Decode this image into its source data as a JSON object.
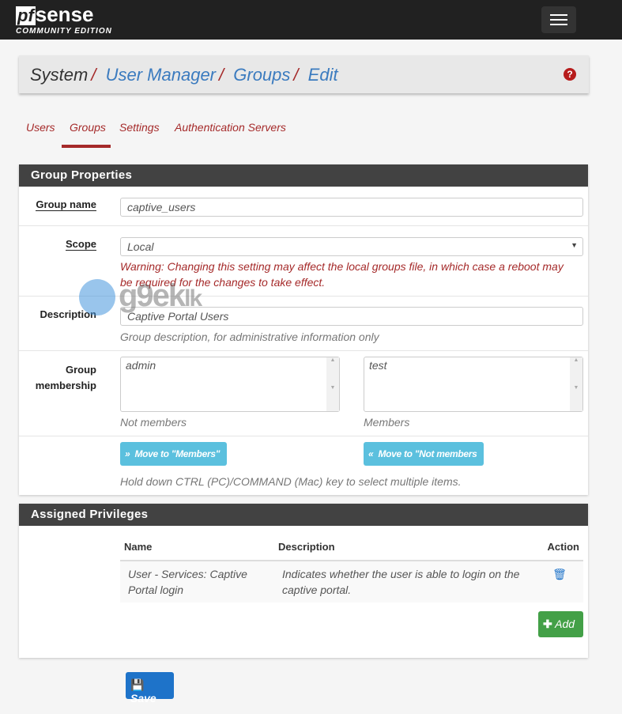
{
  "header": {
    "logo_main": "pfsense",
    "logo_sub": "COMMUNITY EDITION",
    "menu_icon": "hamburger-icon"
  },
  "breadcrumb": {
    "items": [
      "System",
      "User Manager",
      "Groups",
      "Edit"
    ],
    "help_icon": "question-circle-icon"
  },
  "tabs": [
    {
      "label": "Users"
    },
    {
      "label": "Groups",
      "active": true
    },
    {
      "label": "Settings"
    },
    {
      "label": "Authentication Servers"
    }
  ],
  "group_properties": {
    "title": "Group Properties",
    "group_name": {
      "label": "Group name",
      "value": "captive_users"
    },
    "scope": {
      "label": "Scope",
      "value": "Local",
      "warning": "Warning: Changing this setting may affect the local groups file, in which case a reboot may be required for the changes to take effect."
    },
    "description": {
      "label": "Description",
      "value": "Captive Portal Users",
      "help": "Group description, for administrative information only"
    },
    "membership": {
      "label_line1": "Group",
      "label_line2": "membership",
      "not_members": [
        "admin"
      ],
      "members": [
        "test"
      ],
      "not_members_label": "Not members",
      "members_label": "Members"
    },
    "move_to_members": "Move to \"Members\"",
    "move_to_not_members": "Move to \"Not members",
    "multi_select_help": "Hold down CTRL (PC)/COMMAND (Mac) key to select multiple items."
  },
  "privileges": {
    "title": "Assigned Privileges",
    "columns": [
      "Name",
      "Description",
      "Action"
    ],
    "rows": [
      {
        "name": "User - Services: Captive Portal login",
        "description": "Indicates whether the user is able to login on the captive portal."
      }
    ],
    "add_label": "Add"
  },
  "save_label": "Save",
  "watermark": "geeklk",
  "colors": {
    "navbar": "#212121",
    "accent": "#a52a2a",
    "link": "#3b7bbf",
    "info": "#5bc0de",
    "success": "#43a047",
    "primary": "#1e73c9"
  }
}
